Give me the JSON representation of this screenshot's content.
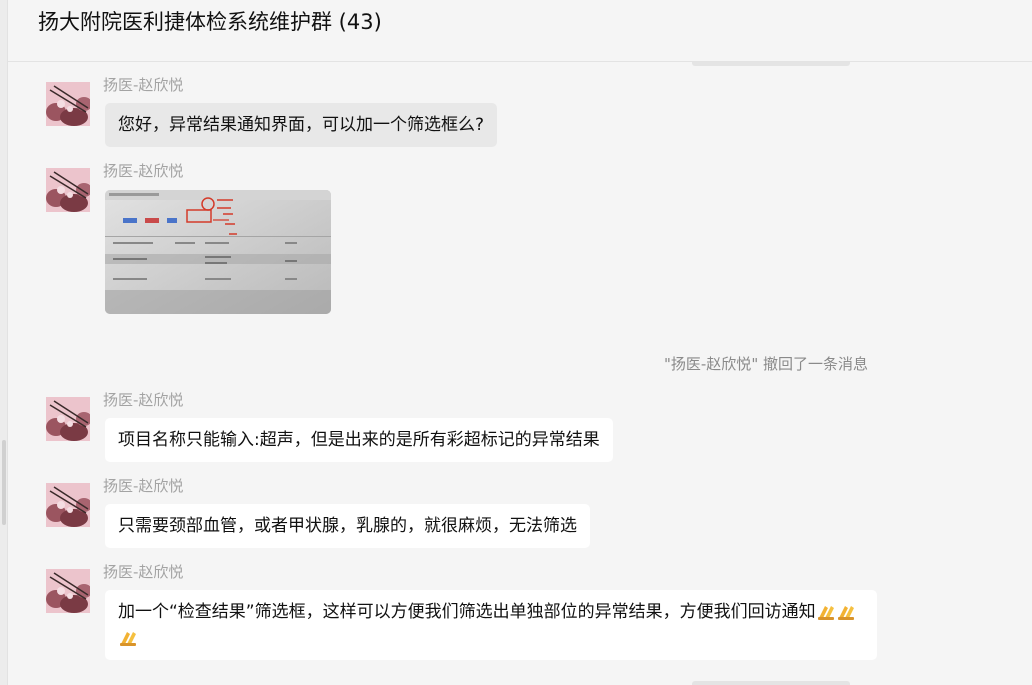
{
  "chat": {
    "title": "扬大附院医利捷体检系统维护群 (43)",
    "recall_notice": "\"扬医-赵欣悦\" 撤回了一条消息"
  },
  "messages": [
    {
      "sender": "扬医-赵欣悦",
      "text": "您好，异常结果通知界面，可以加一个筛选框么?"
    },
    {
      "sender": "扬医-赵欣悦",
      "image": "screenshot-photo"
    },
    {
      "sender": "扬医-赵欣悦",
      "text": "项目名称只能输入:超声，但是出来的是所有彩超标记的异常结果"
    },
    {
      "sender": "扬医-赵欣悦",
      "text": "只需要颈部血管，或者甲状腺，乳腺的，就很麻烦，无法筛选"
    },
    {
      "sender": "扬医-赵欣悦",
      "text": "加一个“检查结果”筛选框，这样可以方便我们筛选出单独部位的异常结果，方便我们回访通知"
    }
  ],
  "icons": {
    "praying-hands": "praying-hands-emoji"
  },
  "colors": {
    "background": "#f5f5f5",
    "bubble": "#ffffff",
    "sender": "#a3a3a3",
    "recall": "#8a8a8a"
  }
}
